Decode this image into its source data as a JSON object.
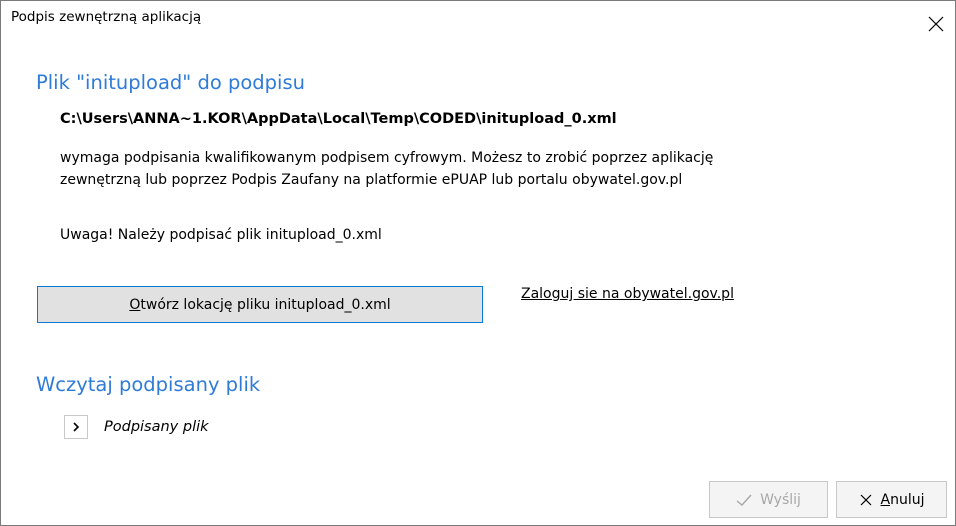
{
  "window": {
    "title": "Podpis zewnętrzną aplikacją"
  },
  "section_file": {
    "heading": "Plik \"initupload\" do podpisu",
    "path": "C:\\Users\\ANNA~1.KOR\\AppData\\Local\\Temp\\CODED\\initupload_0.xml",
    "description_line1": "wymaga podpisania kwalifikowanym podpisem cyfrowym. Możesz to zrobić poprzez aplikację",
    "description_line2": "zewnętrzną lub poprzez Podpis Zaufany na platformie ePUAP lub portalu obywatel.gov.pl",
    "warning": "Uwaga! Należy podpisać plik initupload_0.xml",
    "open_button_first": "O",
    "open_button_rest": "twórz lokację pliku initupload_0.xml",
    "login_link": "Zaloguj sie na obywatel.gov.pl"
  },
  "section_load": {
    "heading": "Wczytaj podpisany plik",
    "expander_label": "Podpisany plik",
    "expander_icon": "chevron-right-icon"
  },
  "footer": {
    "send_label": "Wyślij",
    "send_icon": "check-icon",
    "cancel_first": "A",
    "cancel_rest": "nuluj",
    "cancel_icon": "close-icon"
  },
  "colors": {
    "heading": "#2f7bd8",
    "primary_button_border": "#0a79d6",
    "disabled_text": "#a8a8a8"
  }
}
